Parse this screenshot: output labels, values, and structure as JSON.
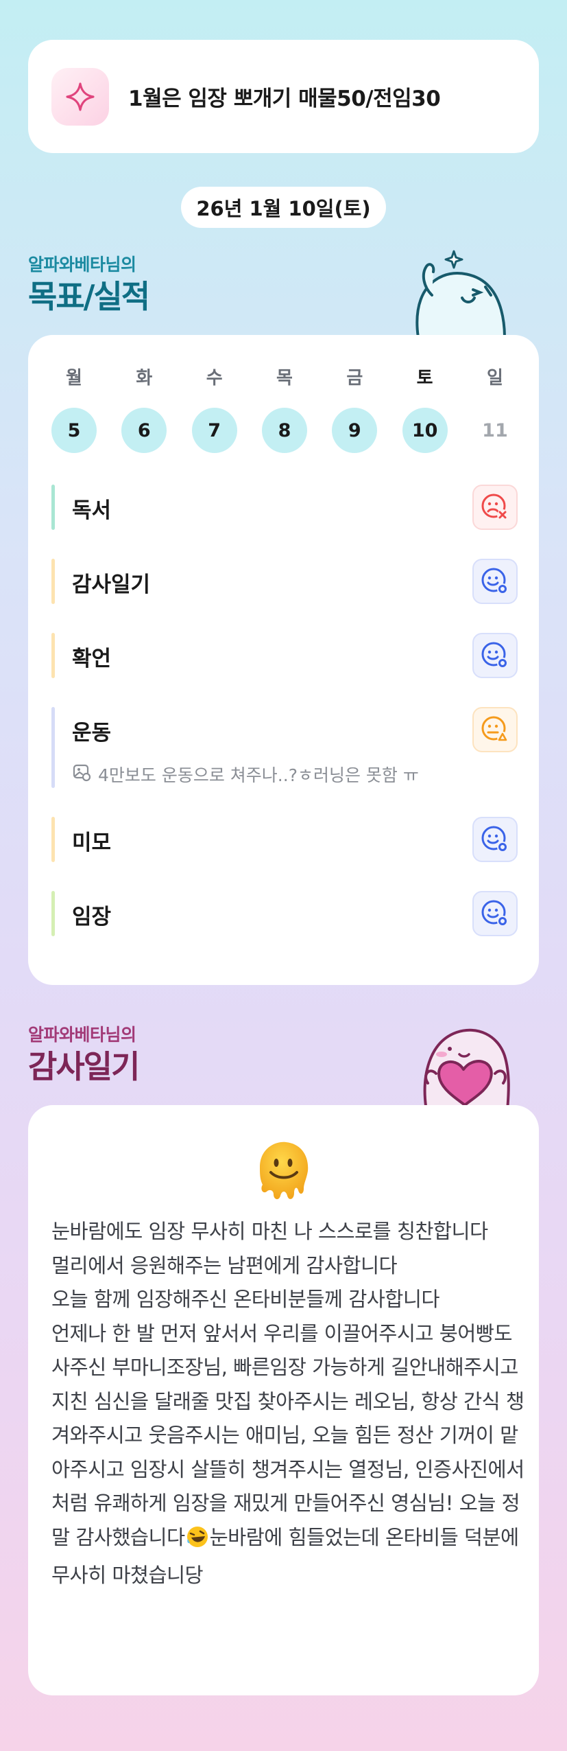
{
  "banner": {
    "icon": "sparkle-icon",
    "text": "1월은 임장 뽀개기 매물50/전임30"
  },
  "date_label": "26년 1월 10일(토)",
  "goals_section": {
    "subtitle": "알파와베타님의",
    "title": "목표/실적",
    "week": [
      {
        "day": "월",
        "date": "5",
        "state": "done"
      },
      {
        "day": "화",
        "date": "6",
        "state": "done"
      },
      {
        "day": "수",
        "date": "7",
        "state": "done"
      },
      {
        "day": "목",
        "date": "8",
        "state": "done"
      },
      {
        "day": "금",
        "date": "9",
        "state": "done"
      },
      {
        "day": "토",
        "date": "10",
        "state": "today"
      },
      {
        "day": "일",
        "date": "11",
        "state": "future"
      }
    ],
    "goals": [
      {
        "label": "독서",
        "bar_color": "#a9e6d3",
        "status": "fail",
        "status_icon": "sad-face-x-icon"
      },
      {
        "label": "감사일기",
        "bar_color": "#fde3b0",
        "status": "success",
        "status_icon": "smile-face-o-icon"
      },
      {
        "label": "확언",
        "bar_color": "#fde3b0",
        "status": "success",
        "status_icon": "smile-face-o-icon"
      },
      {
        "label": "운동",
        "bar_color": "#d6dcf7",
        "status": "partial",
        "status_icon": "neutral-face-triangle-icon",
        "note": "4만보도 운동으로 쳐주나..?ㅎ러닝은 못함 ㅠ"
      },
      {
        "label": "미모",
        "bar_color": "#fde3b0",
        "status": "success",
        "status_icon": "smile-face-o-icon"
      },
      {
        "label": "임장",
        "bar_color": "#d5efb4",
        "status": "success",
        "status_icon": "smile-face-o-icon"
      }
    ]
  },
  "gratitude_section": {
    "subtitle": "알파와베타님의",
    "title": "감사일기",
    "emoji": "melting-face-icon",
    "text_before_emoji": "눈바람에도 임장 무사히 마친 나 스스로를 칭찬합니다\n멀리에서 응원해주는 남편에게 감사합니다\n오늘 함께 임장해주신 온타비분들께 감사합니다\n언제나 한 발 먼저 앞서서 우리를 이끌어주시고 붕어빵도 사주신 부마니조장님, 빠른임장 가능하게 길안내해주시고 지친 심신을 달래줄 맛집 찾아주시는 레오님, 항상 간식 챙겨와주시고 웃음주시는 애미님, 오늘 힘든 정산 기꺼이 맡아주시고 임장시 살뜰히 챙겨주시는 열정님, 인증사진에서처럼 유쾌하게 임장을 재밌게 만들어주신 영심님! 오늘 정말 감사했습니다",
    "inline_emoji": "rofl-emoji-icon",
    "text_after_emoji": "눈바람에 힘들었는데 온타비들 덕분에 무사히 마쳤습니당"
  },
  "colors": {
    "date_done": "#c3eff3",
    "success": "#3a63e8",
    "fail": "#ef4a4a",
    "partial": "#f59a1b"
  }
}
